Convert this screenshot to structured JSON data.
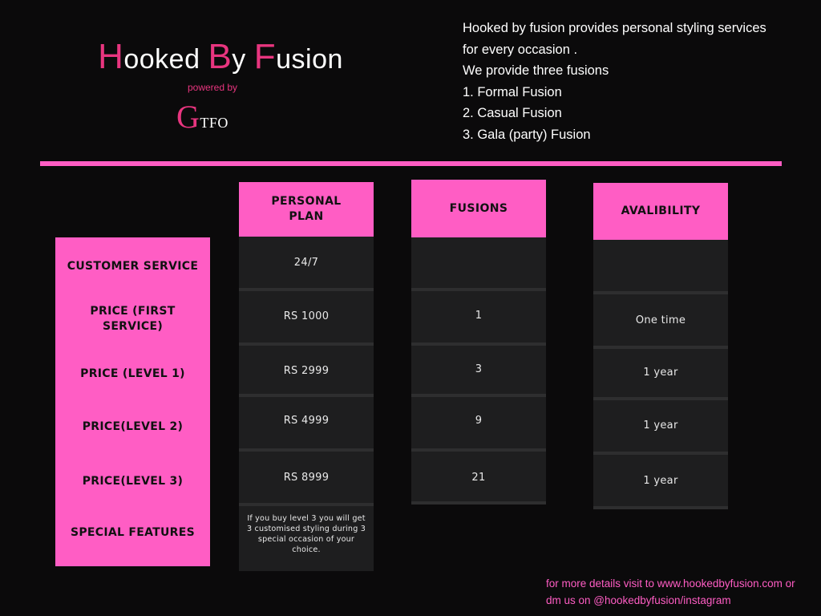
{
  "logo": {
    "part1_initial": "H",
    "part1_rest": "ooked ",
    "part2_initial": "B",
    "part2_rest": "y ",
    "part3_initial": "F",
    "part3_rest": "usion",
    "powered_by": "powered by",
    "gtfo_initial": "G",
    "gtfo_rest": "TFO"
  },
  "intro": {
    "line1": "Hooked by fusion provides personal styling services",
    "line2": "for every occasion .",
    "line3": "We provide three fusions",
    "line4": "1. Formal Fusion",
    "line5": "2. Casual Fusion",
    "line6": "3. Gala (party) Fusion"
  },
  "columns": {
    "personal_plan_line1": "PERSONAL",
    "personal_plan_line2": "PLAN",
    "fusions": "FUSIONS",
    "availability": "AVALIBILITY"
  },
  "rows": {
    "customer_service": "CUSTOMER SERVICE",
    "price_first_line1": "PRICE (FIRST",
    "price_first_line2": "SERVICE)",
    "price_level1": "PRICE (LEVEL 1)",
    "price_level2": "PRICE(LEVEL 2)",
    "price_level3": "PRICE(LEVEL 3)",
    "special_features": "SPECIAL FEATURES"
  },
  "personal_plan": {
    "customer_service": "24/7",
    "price_first": "RS 1000",
    "price_level1": "RS 2999",
    "price_level2": "RS 4999",
    "price_level3": "RS 8999",
    "special_features": "If you buy level 3 you will get 3 customised styling during 3 special occasion of your choice."
  },
  "fusions": {
    "customer_service": "",
    "price_first": "1",
    "price_level1": "3",
    "price_level2": "9",
    "price_level3": "21"
  },
  "availability": {
    "customer_service": "",
    "price_first": "One time",
    "price_level1": "1 year",
    "price_level2": "1 year",
    "price_level3": "1 year"
  },
  "footer": {
    "line1": "for more details visit to www.hookedbyfusion.com or",
    "line2": "dm us on @hookedbyfusion/instagram"
  },
  "colors": {
    "background": "#0b0a0b",
    "accent_pink": "#ff5dc4",
    "logo_pink": "#e8357f",
    "cell_dark": "#1e1e1f"
  }
}
